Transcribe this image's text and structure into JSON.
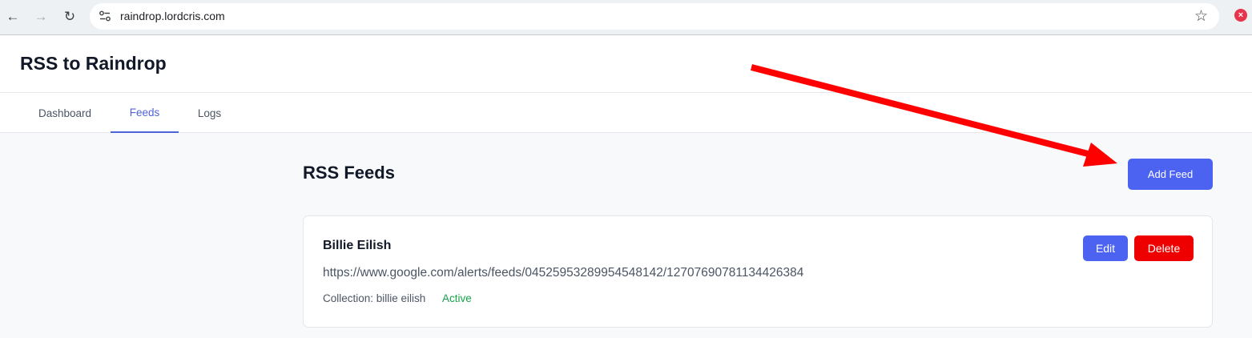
{
  "browser": {
    "url": "raindrop.lordcris.com",
    "back_icon": "arrow-left-icon",
    "forward_icon": "arrow-right-icon",
    "reload_icon": "reload-icon",
    "bookmark_icon": "star-icon",
    "close_icon": "close-icon"
  },
  "app": {
    "title": "RSS to Raindrop"
  },
  "tabs": [
    {
      "label": "Dashboard",
      "active": false
    },
    {
      "label": "Feeds",
      "active": true
    },
    {
      "label": "Logs",
      "active": false
    }
  ],
  "main": {
    "title": "RSS Feeds",
    "add_label": "Add Feed"
  },
  "feeds": [
    {
      "name": "Billie Eilish",
      "url": "https://www.google.com/alerts/feeds/04525953289954548142/12707690781134426384",
      "collection": "Collection: billie eilish",
      "status": "Active",
      "edit_label": "Edit",
      "delete_label": "Delete"
    }
  ],
  "colors": {
    "accent": "#4c63f2",
    "danger": "#ee0000",
    "active_status": "#16a34a",
    "annotation_arrow": "#ff0000"
  }
}
